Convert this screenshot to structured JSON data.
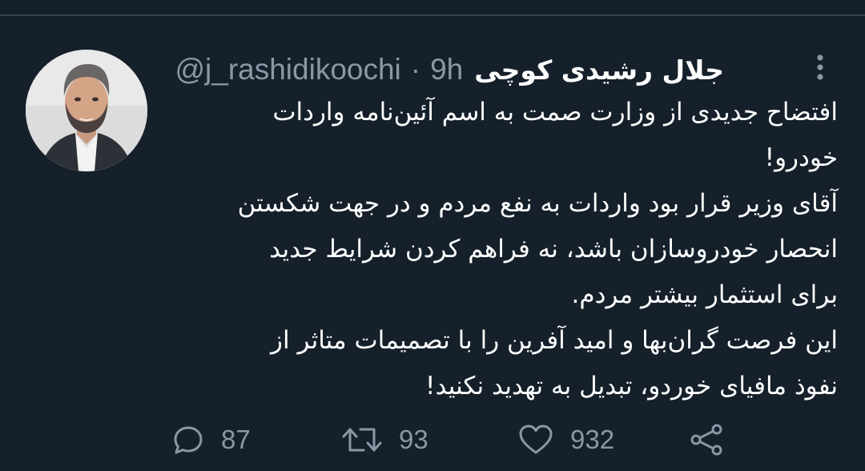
{
  "colors": {
    "background": "#15202b",
    "text_primary": "#ffffff",
    "text_secondary": "#8899a6",
    "divider": "#38444d"
  },
  "tweet": {
    "author": {
      "display_name": "جلال رشیدی کوچی",
      "handle": "@j_rashidikoochi",
      "avatar_icon": "profile-photo"
    },
    "separator": "·",
    "time": "9h",
    "more_icon": "vertical-ellipsis-icon",
    "body_lines": [
      "افتضاح جدیدی از وزارت صمت به اسم آئین‌نامه واردات",
      "خودرو!",
      "آقای وزیر قرار بود واردات به نفع مردم و در جهت شکستن",
      "انحصار خودروسازان باشد، نه فراهم کردن شرایط جدید",
      "برای استثمار بیشتر مردم.",
      "این فرصت گران‌بها و امید آفرین را با تصمیمات متاثر از",
      "نفوذ مافیای خوردو، تبدیل به تهدید نکنید!"
    ],
    "actions": {
      "reply": {
        "icon": "reply-icon",
        "count": "87"
      },
      "retweet": {
        "icon": "retweet-icon",
        "count": "93"
      },
      "like": {
        "icon": "heart-icon",
        "count": "932"
      },
      "share": {
        "icon": "share-icon"
      }
    }
  }
}
